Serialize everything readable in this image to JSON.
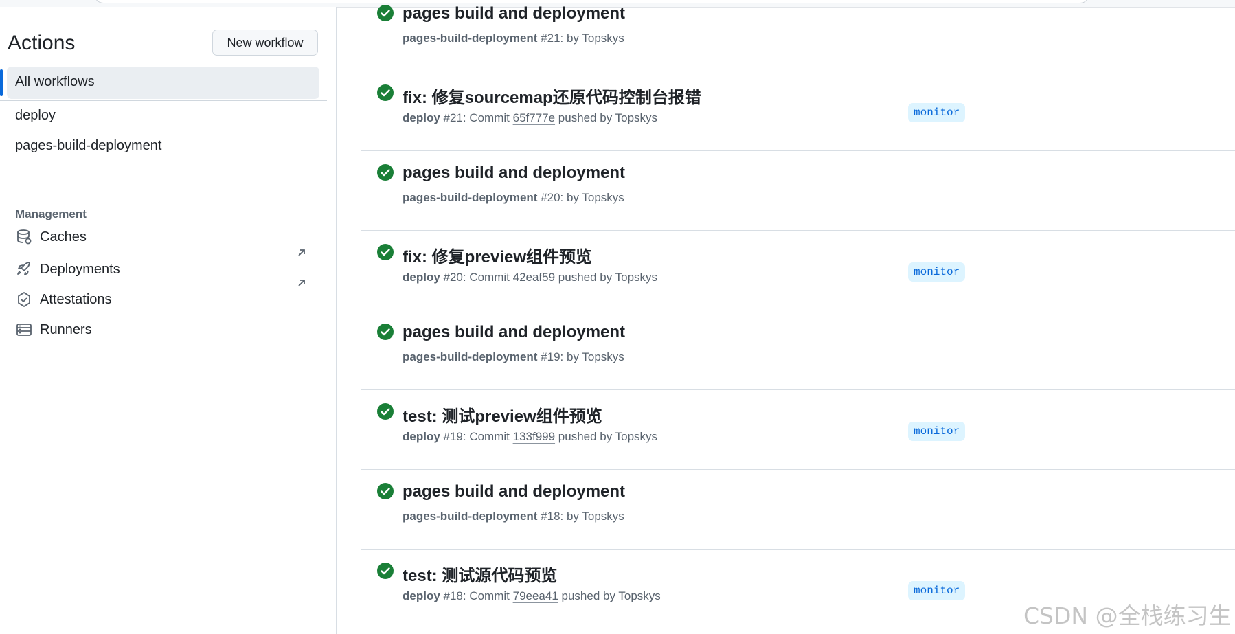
{
  "sidebar": {
    "title": "Actions",
    "new_workflow_label": "New workflow",
    "all_workflows_label": "All workflows",
    "workflows": [
      "deploy",
      "pages-build-deployment"
    ],
    "management_label": "Management",
    "management_items": [
      {
        "label": "Caches",
        "icon": "database-icon",
        "external": false
      },
      {
        "label": "Deployments",
        "icon": "rocket-icon",
        "external": true
      },
      {
        "label": "Attestations",
        "icon": "shield-check-icon",
        "external": true
      },
      {
        "label": "Runners",
        "icon": "server-icon",
        "external": false
      }
    ]
  },
  "runs": [
    {
      "title": "pages build and deployment",
      "workflow": "pages-build-deployment",
      "run_num": " #21: by Topskys",
      "commit": "",
      "after_commit": "",
      "branch": "",
      "status_icon": "check-circle-icon",
      "status_color": "#1a7f37"
    },
    {
      "title": "fix: 修复sourcemap还原代码控制台报错",
      "workflow": "deploy",
      "run_num": " #21: Commit ",
      "commit": "65f777e",
      "after_commit": " pushed by Topskys",
      "branch": "monitor",
      "status_icon": "check-circle-icon",
      "status_color": "#1a7f37"
    },
    {
      "title": "pages build and deployment",
      "workflow": "pages-build-deployment",
      "run_num": " #20: by Topskys",
      "commit": "",
      "after_commit": "",
      "branch": "",
      "status_icon": "check-circle-icon",
      "status_color": "#1a7f37"
    },
    {
      "title": "fix: 修复preview组件预览",
      "workflow": "deploy",
      "run_num": " #20: Commit ",
      "commit": "42eaf59",
      "after_commit": " pushed by Topskys",
      "branch": "monitor",
      "status_icon": "check-circle-icon",
      "status_color": "#1a7f37"
    },
    {
      "title": "pages build and deployment",
      "workflow": "pages-build-deployment",
      "run_num": " #19: by Topskys",
      "commit": "",
      "after_commit": "",
      "branch": "",
      "status_icon": "check-circle-icon",
      "status_color": "#1a7f37"
    },
    {
      "title": "test: 测试preview组件预览",
      "workflow": "deploy",
      "run_num": " #19: Commit ",
      "commit": "133f999",
      "after_commit": " pushed by Topskys",
      "branch": "monitor",
      "status_icon": "check-circle-icon",
      "status_color": "#1a7f37"
    },
    {
      "title": "pages build and deployment",
      "workflow": "pages-build-deployment",
      "run_num": " #18: by Topskys",
      "commit": "",
      "after_commit": "",
      "branch": "",
      "status_icon": "check-circle-icon",
      "status_color": "#1a7f37"
    },
    {
      "title": "test: 测试源代码预览",
      "workflow": "deploy",
      "run_num": " #18: Commit ",
      "commit": "79eea41",
      "after_commit": " pushed by Topskys",
      "branch": "monitor",
      "status_icon": "check-circle-icon",
      "status_color": "#1a7f37"
    }
  ],
  "watermark": "CSDN @全栈练习生",
  "colors": {
    "accent": "#0969da",
    "success": "#1a7f37",
    "branch_bg": "#ddf4ff"
  }
}
